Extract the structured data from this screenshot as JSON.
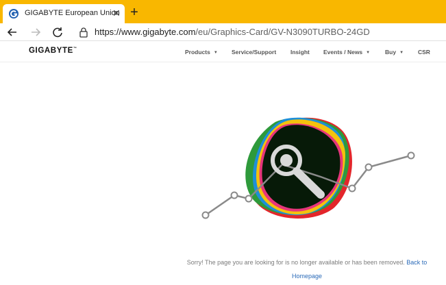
{
  "browser": {
    "tab_title": "GIGABYTE European Union",
    "url_host": "https://www.gigabyte.com",
    "url_path": "/eu/Graphics-Card/GV-N3090TURBO-24GD",
    "colors": {
      "tabstrip": "#f9b700"
    }
  },
  "site": {
    "logo": "GIGABYTE",
    "nav": {
      "products": "Products",
      "service": "Service/Support",
      "insight": "Insight",
      "events": "Events / News",
      "buy": "Buy",
      "csr": "CSR"
    }
  },
  "error": {
    "message": "Sorry! The page you are looking for is no longer available or has been removed.",
    "link_label": "Back to Homepage"
  }
}
